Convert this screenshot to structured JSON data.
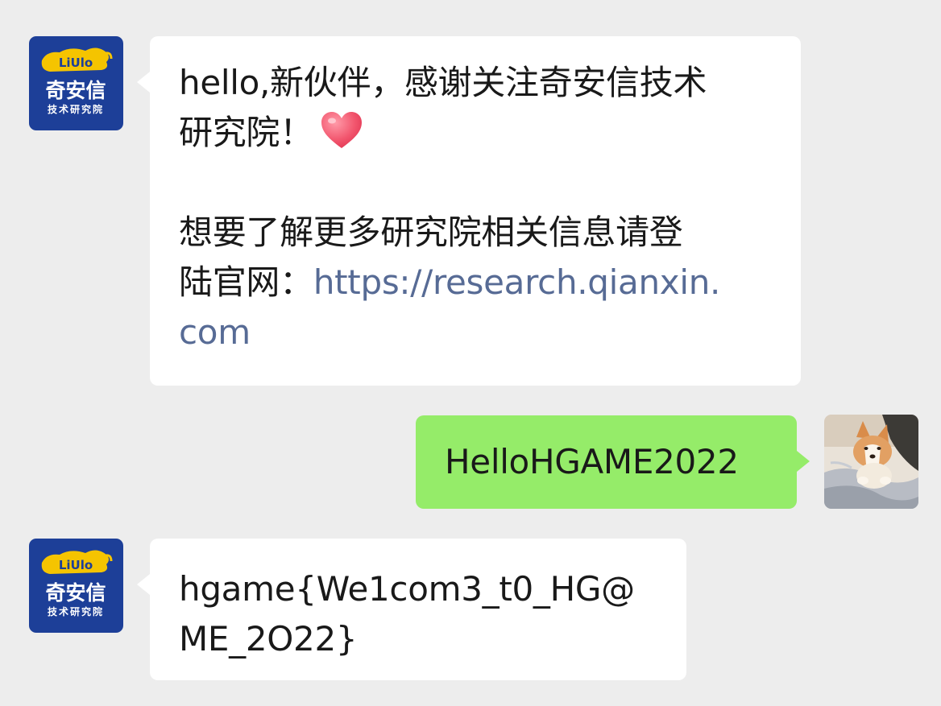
{
  "messages": [
    {
      "sender": "official-account",
      "avatar": {
        "brand_main": "奇安信",
        "brand_sub": "技术研究院",
        "logo_text": "LiUlo",
        "bg_color": "#1d3f98",
        "accent_color": "#f5c400"
      },
      "line1": "hello,新伙伴，感谢关注奇安信技术",
      "line2": "研究院！",
      "emoji": "heart-emoji",
      "line3": "想要了解更多研究院相关信息请登",
      "line4_prefix": "陆官网：",
      "link_part1": "https://research.qianxin.",
      "link_part2": "com"
    },
    {
      "sender": "me",
      "text": "HelloHGAME2022",
      "avatar": "corgi-puppy-photo"
    },
    {
      "sender": "official-account",
      "line1": "hgame{We1com3_t0_HG@",
      "line2": "ME_2O22}"
    }
  ],
  "colors": {
    "background": "#ededed",
    "incoming_bubble": "#ffffff",
    "outgoing_bubble": "#95ec69",
    "link": "#576b95",
    "text": "#191919"
  }
}
